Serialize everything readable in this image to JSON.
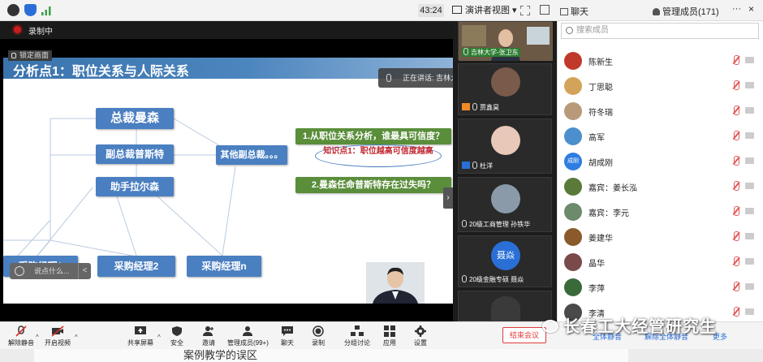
{
  "topbar": {
    "timer": "43:24",
    "view_label": "演讲者视图",
    "chat_tab": "聊天",
    "members_tab": "管理成员(171)",
    "more": "···",
    "close": "×"
  },
  "recording": {
    "label": "录制中",
    "lock_label": "锁定画面"
  },
  "slide": {
    "title": "分析点1：职位关系与人际关系",
    "boxes": {
      "ceo": "总裁曼森",
      "vp": "副总裁普斯特",
      "other_vp": "其他副总裁。。。",
      "assistant": "助手拉尔森",
      "m1": "采购经理1",
      "m2": "采购经理2",
      "mn": "采购经理n"
    },
    "q1": "1.从职位关系分析，谁最具可信度？",
    "knowledge": "知识点1：职位越高可信度越高",
    "q2": "2.曼森任命普斯特存在过失吗？",
    "chat_placeholder": "说点什么...",
    "chat_arrow": "<"
  },
  "speaking": "正在讲话: 吉林大学-张卫东;",
  "tiles": [
    {
      "name": "吉林大学-张卫东"
    },
    {
      "name": "贾鑫昊"
    },
    {
      "name": "杜洋"
    },
    {
      "name": "20级工商管理 孙铁华"
    },
    {
      "name": "20级金融专硕 聂焱",
      "avatar_text": "聂焱"
    },
    {
      "name": ""
    }
  ],
  "collapse_arrow": "›",
  "members": {
    "search_placeholder": "搜索成员",
    "list": [
      {
        "name": "陈新生",
        "color": "#c0392b"
      },
      {
        "name": "丁思聪",
        "color": "#d4a35a"
      },
      {
        "name": "符冬瑞",
        "color": "#b89a7a"
      },
      {
        "name": "高军",
        "color": "#4b8fce"
      },
      {
        "name": "胡成刚",
        "color": "#2f7de1",
        "avatar_text": "成刚"
      },
      {
        "name": "嘉宾：姜长泓",
        "color": "#5a7a3a"
      },
      {
        "name": "嘉宾：李元",
        "color": "#6d8a6a"
      },
      {
        "name": "姜建华",
        "color": "#8a5a2a"
      },
      {
        "name": "晶华",
        "color": "#7a4a4a"
      },
      {
        "name": "李萍",
        "color": "#3a6a3a"
      },
      {
        "name": "李清",
        "color": "#4a4a4a"
      }
    ],
    "footer_invite": "全体静音",
    "footer_mute": "解除全体静音",
    "footer_more": "更多"
  },
  "toolbar": {
    "unmute": "解除静音",
    "video": "开启视频",
    "share": "共享屏幕",
    "security": "安全",
    "invite": "邀请",
    "members": "管理成员(99+)",
    "chat": "聊天",
    "record": "录制",
    "breakout": "分组讨论",
    "apps": "应用",
    "settings": "设置",
    "end": "结束会议"
  },
  "watermark": "长春工大经管研究生",
  "bottom_text": "案例教学的误区"
}
